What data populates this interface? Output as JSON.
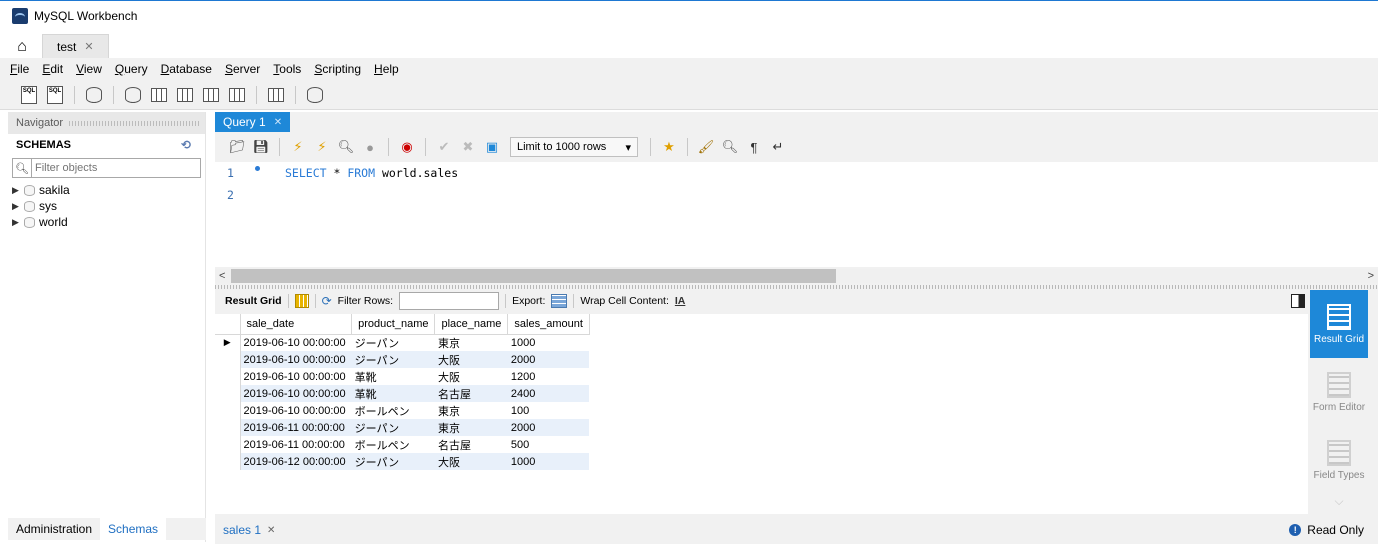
{
  "window": {
    "title": "MySQL Workbench"
  },
  "connection_tab": {
    "label": "test"
  },
  "menu": [
    "File",
    "Edit",
    "View",
    "Query",
    "Database",
    "Server",
    "Tools",
    "Scripting",
    "Help"
  ],
  "navigator": {
    "header": "Navigator",
    "schemas_label": "SCHEMAS",
    "filter_placeholder": "Filter objects",
    "schemas": [
      "sakila",
      "sys",
      "world"
    ],
    "bottom_tabs": [
      "Administration",
      "Schemas"
    ],
    "active_bottom_tab": "Schemas"
  },
  "query_tab": {
    "label": "Query 1"
  },
  "sql_toolbar": {
    "limit": "Limit to 1000 rows"
  },
  "editor": {
    "lines": [
      {
        "num": "1",
        "keyword1": "SELECT",
        "op": " * ",
        "keyword2": "FROM",
        "rest": " world.sales"
      },
      {
        "num": "2",
        "keyword1": "",
        "op": "",
        "keyword2": "",
        "rest": ""
      }
    ]
  },
  "result_toolbar": {
    "result_grid": "Result Grid",
    "filter_rows": "Filter Rows:",
    "export": "Export:",
    "wrap": "Wrap Cell Content:"
  },
  "result": {
    "columns": [
      "sale_date",
      "product_name",
      "place_name",
      "sales_amount"
    ],
    "rows": [
      [
        "2019-06-10 00:00:00",
        "ジーパン",
        "東京",
        "1000"
      ],
      [
        "2019-06-10 00:00:00",
        "ジーパン",
        "大阪",
        "2000"
      ],
      [
        "2019-06-10 00:00:00",
        "革靴",
        "大阪",
        "1200"
      ],
      [
        "2019-06-10 00:00:00",
        "革靴",
        "名古屋",
        "2400"
      ],
      [
        "2019-06-10 00:00:00",
        "ボールペン",
        "東京",
        "100"
      ],
      [
        "2019-06-11 00:00:00",
        "ジーパン",
        "東京",
        "2000"
      ],
      [
        "2019-06-11 00:00:00",
        "ボールペン",
        "名古屋",
        "500"
      ],
      [
        "2019-06-12 00:00:00",
        "ジーパン",
        "大阪",
        "1000"
      ]
    ]
  },
  "side_panel": [
    {
      "label": "Result Grid",
      "active": true
    },
    {
      "label": "Form Editor",
      "active": false
    },
    {
      "label": "Field Types",
      "active": false
    }
  ],
  "bottom": {
    "result_tab": "sales 1",
    "status": "Read Only"
  },
  "colors": {
    "accent": "#1e88d8",
    "keyword": "#2a7bd6",
    "alt_row": "#e8f0fa"
  }
}
